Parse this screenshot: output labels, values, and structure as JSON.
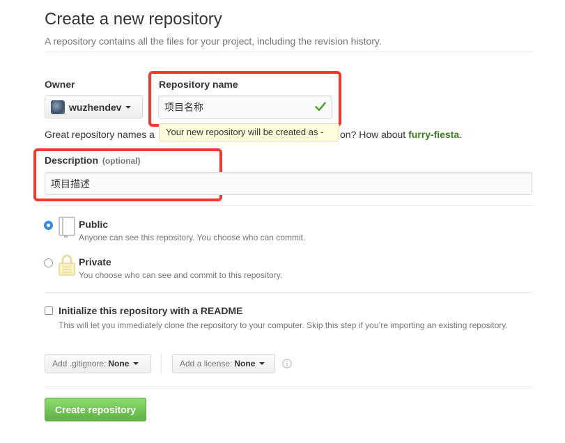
{
  "header": {
    "title": "Create a new repository",
    "subtitle": "A repository contains all the files for your project, including the revision history."
  },
  "owner": {
    "label": "Owner",
    "value": "wuzhendev"
  },
  "repo_name": {
    "label": "Repository name",
    "value": "项目名称",
    "valid_icon": "check-icon"
  },
  "tooltip": {
    "text": "Your new repository will be created as -"
  },
  "hint": {
    "prefix": "Great repository names a",
    "suffix": "on? How about",
    "suggestion": "furry-fiesta",
    "end": "."
  },
  "description": {
    "label": "Description",
    "optional": "(optional)",
    "value": "项目描述"
  },
  "visibility": {
    "public": {
      "title": "Public",
      "desc": "Anyone can see this repository. You choose who can commit.",
      "selected": true,
      "icon": "repo-book-icon"
    },
    "private": {
      "title": "Private",
      "desc": "You choose who can see and commit to this repository.",
      "selected": false,
      "icon": "lock-icon"
    }
  },
  "readme": {
    "title": "Initialize this repository with a README",
    "desc": "This will let you immediately clone the repository to your computer. Skip this step if you’re importing an existing repository.",
    "checked": false
  },
  "gitignore": {
    "label": "Add .gitignore:",
    "value": "None"
  },
  "license": {
    "label": "Add a license:",
    "value": "None",
    "info_icon": "info-icon"
  },
  "submit": {
    "label": "Create repository"
  },
  "colors": {
    "highlight_box": "#f03a2e",
    "create_button": "#60b044",
    "suggestion": "#3b7d1e",
    "radio_selected": "#3b8fe8"
  }
}
